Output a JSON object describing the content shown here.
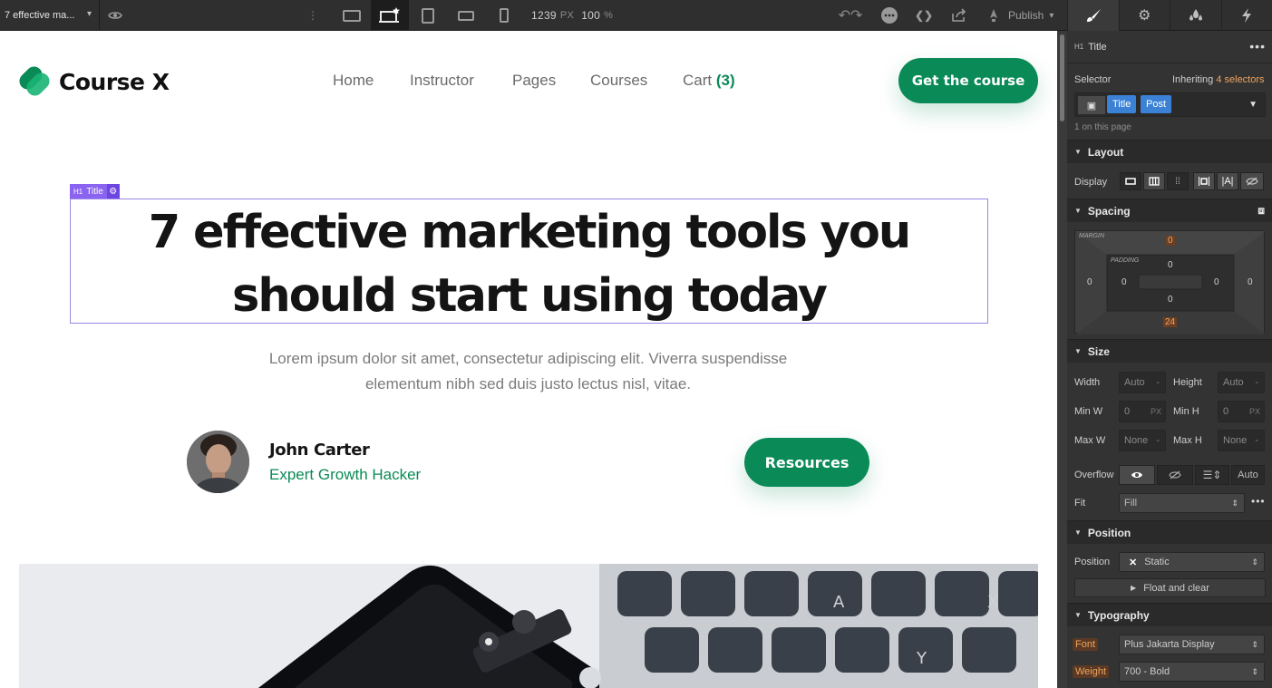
{
  "topbar": {
    "page_name": "7 effective ma...",
    "width_value": "1239",
    "width_unit": "PX",
    "zoom": "100",
    "zoom_unit": "%",
    "publish_label": "Publish"
  },
  "site": {
    "logo_text": "Course X",
    "brand_color": "#0a8a56",
    "nav": {
      "home": "Home",
      "instructor": "Instructor",
      "pages": "Pages",
      "courses": "Courses",
      "cart": "Cart",
      "cart_count": "(3)"
    },
    "cta_label": "Get the course",
    "selection_tag": "Title",
    "selection_prefix": "H1",
    "title_line1": "7 effective marketing tools you",
    "title_line2": "should start using today",
    "lead_line1": "Lorem ipsum dolor sit amet, consectetur adipiscing elit. Viverra suspendisse",
    "lead_line2": "elementum nibh sed duis justo lectus nisl, vitae.",
    "author_name": "John Carter",
    "author_role": "Expert Growth Hacker",
    "resources_label": "Resources"
  },
  "panel": {
    "element_prefix": "H1",
    "element_name": "Title",
    "selector_label": "Selector",
    "inheriting_label": "Inheriting",
    "inheriting_count": "4 selectors",
    "selector_pills": [
      "Title",
      "Post"
    ],
    "on_page": "1 on this page",
    "layout": {
      "heading": "Layout",
      "display_label": "Display"
    },
    "spacing": {
      "heading": "Spacing",
      "margin_label": "MARGIN",
      "padding_label": "PADDING",
      "margin_top": "0",
      "margin_left": "0",
      "margin_right": "0",
      "margin_bottom": "24",
      "padding_top": "0",
      "padding_left": "0",
      "padding_right": "0",
      "padding_bottom": "0"
    },
    "size": {
      "heading": "Size",
      "width_label": "Width",
      "width_value": "Auto",
      "height_label": "Height",
      "height_value": "Auto",
      "minw_label": "Min W",
      "minw_value": "0",
      "minw_unit": "PX",
      "minh_label": "Min H",
      "minh_value": "0",
      "minh_unit": "PX",
      "maxw_label": "Max W",
      "maxw_value": "None",
      "maxh_label": "Max H",
      "maxh_value": "None",
      "overflow_label": "Overflow",
      "overflow_auto": "Auto",
      "fit_label": "Fit",
      "fit_value": "Fill"
    },
    "position": {
      "heading": "Position",
      "position_label": "Position",
      "position_value": "Static",
      "float_label": "Float and clear"
    },
    "typography": {
      "heading": "Typography",
      "font_label": "Font",
      "font_value": "Plus Jakarta Display",
      "weight_label": "Weight",
      "weight_value": "700 - Bold"
    }
  }
}
